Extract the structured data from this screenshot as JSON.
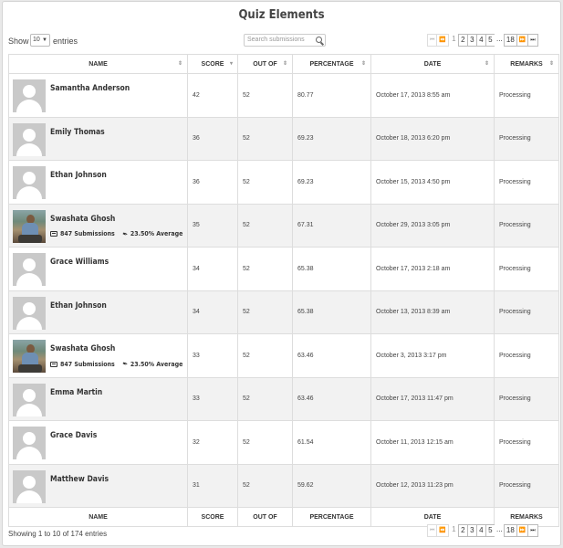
{
  "page": {
    "title": "Quiz Elements"
  },
  "controls": {
    "show_label": "Show",
    "entries_value": "10",
    "entries_label": "entries",
    "search_placeholder": "Search submissions"
  },
  "pagination": {
    "first_icon": "⏮",
    "prev_icon": "⏪",
    "current": "1",
    "pages": [
      "2",
      "3",
      "4",
      "5"
    ],
    "ellipsis": "...",
    "last_page": "18",
    "next_icon": "⏩",
    "last_icon": "⏭"
  },
  "table": {
    "columns": [
      "NAME",
      "SCORE",
      "OUT OF",
      "PERCENTAGE",
      "DATE",
      "REMARKS"
    ],
    "rows": [
      {
        "name": "Samantha Anderson",
        "score": "42",
        "out_of": "52",
        "percentage": "80.77",
        "date": "October 17, 2013 8:55 am",
        "remarks": "Processing",
        "avatar": "placeholder"
      },
      {
        "name": "Emily Thomas",
        "score": "36",
        "out_of": "52",
        "percentage": "69.23",
        "date": "October 18, 2013 6:20 pm",
        "remarks": "Processing",
        "avatar": "placeholder"
      },
      {
        "name": "Ethan Johnson",
        "score": "36",
        "out_of": "52",
        "percentage": "69.23",
        "date": "October 15, 2013 4:50 pm",
        "remarks": "Processing",
        "avatar": "placeholder"
      },
      {
        "name": "Swashata Ghosh",
        "score": "35",
        "out_of": "52",
        "percentage": "67.31",
        "date": "October 29, 2013 3:05 pm",
        "remarks": "Processing",
        "avatar": "photo",
        "submissions": "847 Submissions",
        "average": "23.50% Average"
      },
      {
        "name": "Grace Williams",
        "score": "34",
        "out_of": "52",
        "percentage": "65.38",
        "date": "October 17, 2013 2:18 am",
        "remarks": "Processing",
        "avatar": "placeholder"
      },
      {
        "name": "Ethan Johnson",
        "score": "34",
        "out_of": "52",
        "percentage": "65.38",
        "date": "October 13, 2013 8:39 am",
        "remarks": "Processing",
        "avatar": "placeholder"
      },
      {
        "name": "Swashata Ghosh",
        "score": "33",
        "out_of": "52",
        "percentage": "63.46",
        "date": "October 3, 2013 3:17 pm",
        "remarks": "Processing",
        "avatar": "photo",
        "submissions": "847 Submissions",
        "average": "23.50% Average"
      },
      {
        "name": "Emma Martin",
        "score": "33",
        "out_of": "52",
        "percentage": "63.46",
        "date": "October 17, 2013 11:47 pm",
        "remarks": "Processing",
        "avatar": "placeholder"
      },
      {
        "name": "Grace Davis",
        "score": "32",
        "out_of": "52",
        "percentage": "61.54",
        "date": "October 11, 2013 12:15 am",
        "remarks": "Processing",
        "avatar": "placeholder"
      },
      {
        "name": "Matthew Davis",
        "score": "31",
        "out_of": "52",
        "percentage": "59.62",
        "date": "October 12, 2013 11:23 pm",
        "remarks": "Processing",
        "avatar": "placeholder"
      }
    ]
  },
  "footer": {
    "info": "Showing 1 to 10 of 174 entries"
  }
}
